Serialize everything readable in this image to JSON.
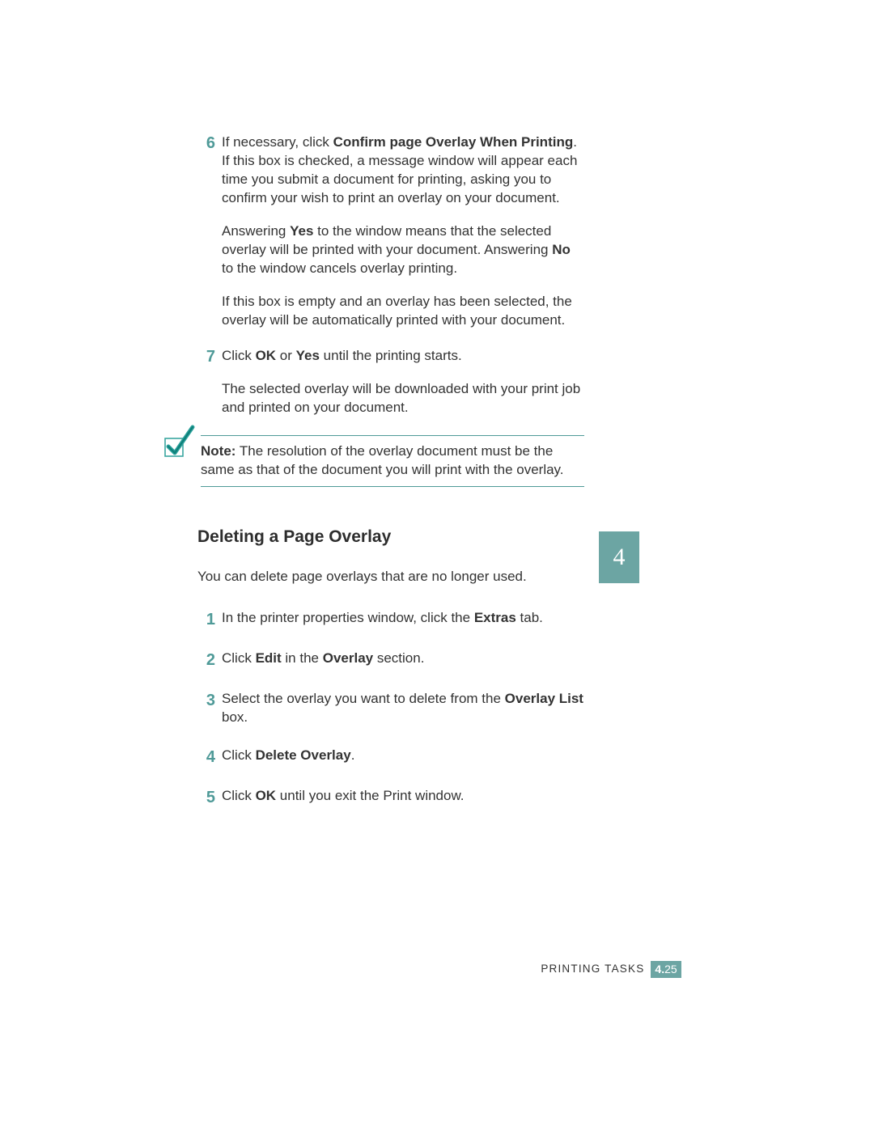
{
  "steps_top": [
    {
      "num": "6",
      "paras": [
        {
          "runs": [
            {
              "t": "If necessary, click "
            },
            {
              "t": "Confirm page Overlay When Printing",
              "b": true
            },
            {
              "t": ". If this box is checked, a message window will appear each time you submit a document for printing, asking you to confirm your wish to print an overlay on your document."
            }
          ]
        },
        {
          "runs": [
            {
              "t": "Answering "
            },
            {
              "t": "Yes",
              "b": true
            },
            {
              "t": " to the window means that the selected overlay will be printed with your document. Answering "
            },
            {
              "t": "No",
              "b": true
            },
            {
              "t": " to the window cancels overlay printing."
            }
          ]
        },
        {
          "runs": [
            {
              "t": "If this box is empty and an overlay has been selected, the overlay will be automatically printed with your document."
            }
          ]
        }
      ]
    },
    {
      "num": "7",
      "paras": [
        {
          "runs": [
            {
              "t": "Click "
            },
            {
              "t": "OK",
              "b": true
            },
            {
              "t": " or "
            },
            {
              "t": "Yes",
              "b": true
            },
            {
              "t": " until the printing starts."
            }
          ]
        },
        {
          "runs": [
            {
              "t": "The selected overlay will be downloaded with your print job and printed on your document."
            }
          ]
        }
      ]
    }
  ],
  "note": {
    "runs": [
      {
        "t": "Note:",
        "b": true
      },
      {
        "t": " The resolution of the overlay document must be the same as that of the document you will print with the overlay."
      }
    ]
  },
  "chapter_tab": "4",
  "section_heading": "Deleting a Page Overlay",
  "section_intro": {
    "runs": [
      {
        "t": "You can delete page overlays that are no longer used."
      }
    ]
  },
  "steps_delete": [
    {
      "num": "1",
      "paras": [
        {
          "runs": [
            {
              "t": "In the printer properties window, click the "
            },
            {
              "t": "Extras",
              "b": true
            },
            {
              "t": " tab."
            }
          ]
        }
      ]
    },
    {
      "num": "2",
      "paras": [
        {
          "runs": [
            {
              "t": "Click "
            },
            {
              "t": "Edit",
              "b": true
            },
            {
              "t": " in the "
            },
            {
              "t": "Overlay",
              "b": true
            },
            {
              "t": " section."
            }
          ]
        }
      ]
    },
    {
      "num": "3",
      "paras": [
        {
          "runs": [
            {
              "t": "Select the overlay you want to delete from the "
            },
            {
              "t": "Overlay List",
              "b": true
            },
            {
              "t": " box."
            }
          ]
        }
      ]
    },
    {
      "num": "4",
      "paras": [
        {
          "runs": [
            {
              "t": "Click "
            },
            {
              "t": "Delete Overlay",
              "b": true
            },
            {
              "t": "."
            }
          ]
        }
      ]
    },
    {
      "num": "5",
      "paras": [
        {
          "runs": [
            {
              "t": "Click "
            },
            {
              "t": "OK",
              "b": true
            },
            {
              "t": " until you exit the Print window."
            }
          ]
        }
      ]
    }
  ],
  "footer": {
    "label": "PRINTING TASKS",
    "chap": "4.",
    "page": "25"
  }
}
